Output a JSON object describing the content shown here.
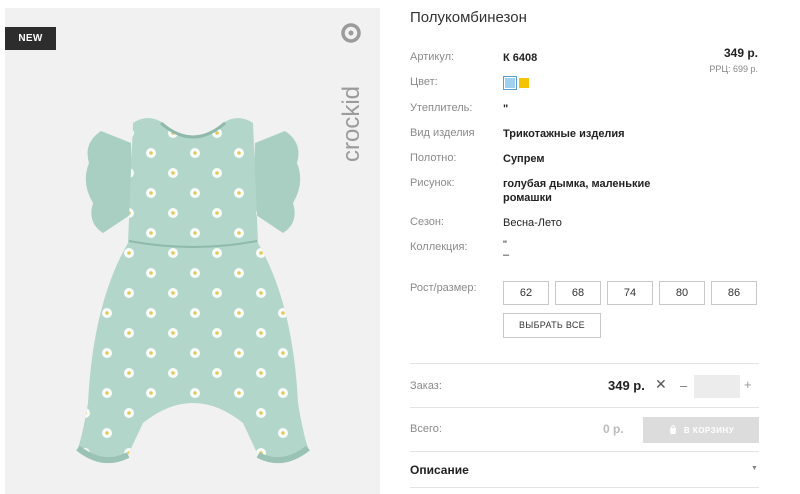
{
  "badge": "NEW",
  "brand": "crockid",
  "product": {
    "title": "Полукомбинезон",
    "price": "349 р.",
    "rrp": "РРЦ: 699 р."
  },
  "properties": {
    "article_label": "Артикул:",
    "article_value": "К 6408",
    "color_label": "Цвет:",
    "colors": [
      "#9fd0f0",
      "#f2c500"
    ],
    "insulation_label": "Утеплитель:",
    "insulation_value": "\"",
    "type_label": "Вид изделия",
    "type_value": "Трикотажные изделия",
    "fabric_label": "Полотно:",
    "fabric_value": "Супрем",
    "pattern_label": "Рисунок:",
    "pattern_value": "голубая дымка, маленькие ромашки",
    "season_label": "Сезон:",
    "season_value": "Весна-Лето",
    "collection_label": "Коллекция:",
    "collection_value_1": "\"",
    "collection_value_2": "–"
  },
  "sizes": {
    "label": "Рост/размер:",
    "options": [
      "62",
      "68",
      "74",
      "80",
      "86"
    ],
    "select_all": "ВЫБРАТЬ ВСЕ"
  },
  "order": {
    "label": "Заказ:",
    "price": "349 р.",
    "remove_glyph": "✕",
    "minus": "–",
    "plus": "+",
    "quantity": ""
  },
  "total": {
    "label": "Всего:",
    "value": "0 р.",
    "cart_button": "В КОРЗИНУ"
  },
  "description": {
    "title": "Описание",
    "arrow": "▼"
  }
}
